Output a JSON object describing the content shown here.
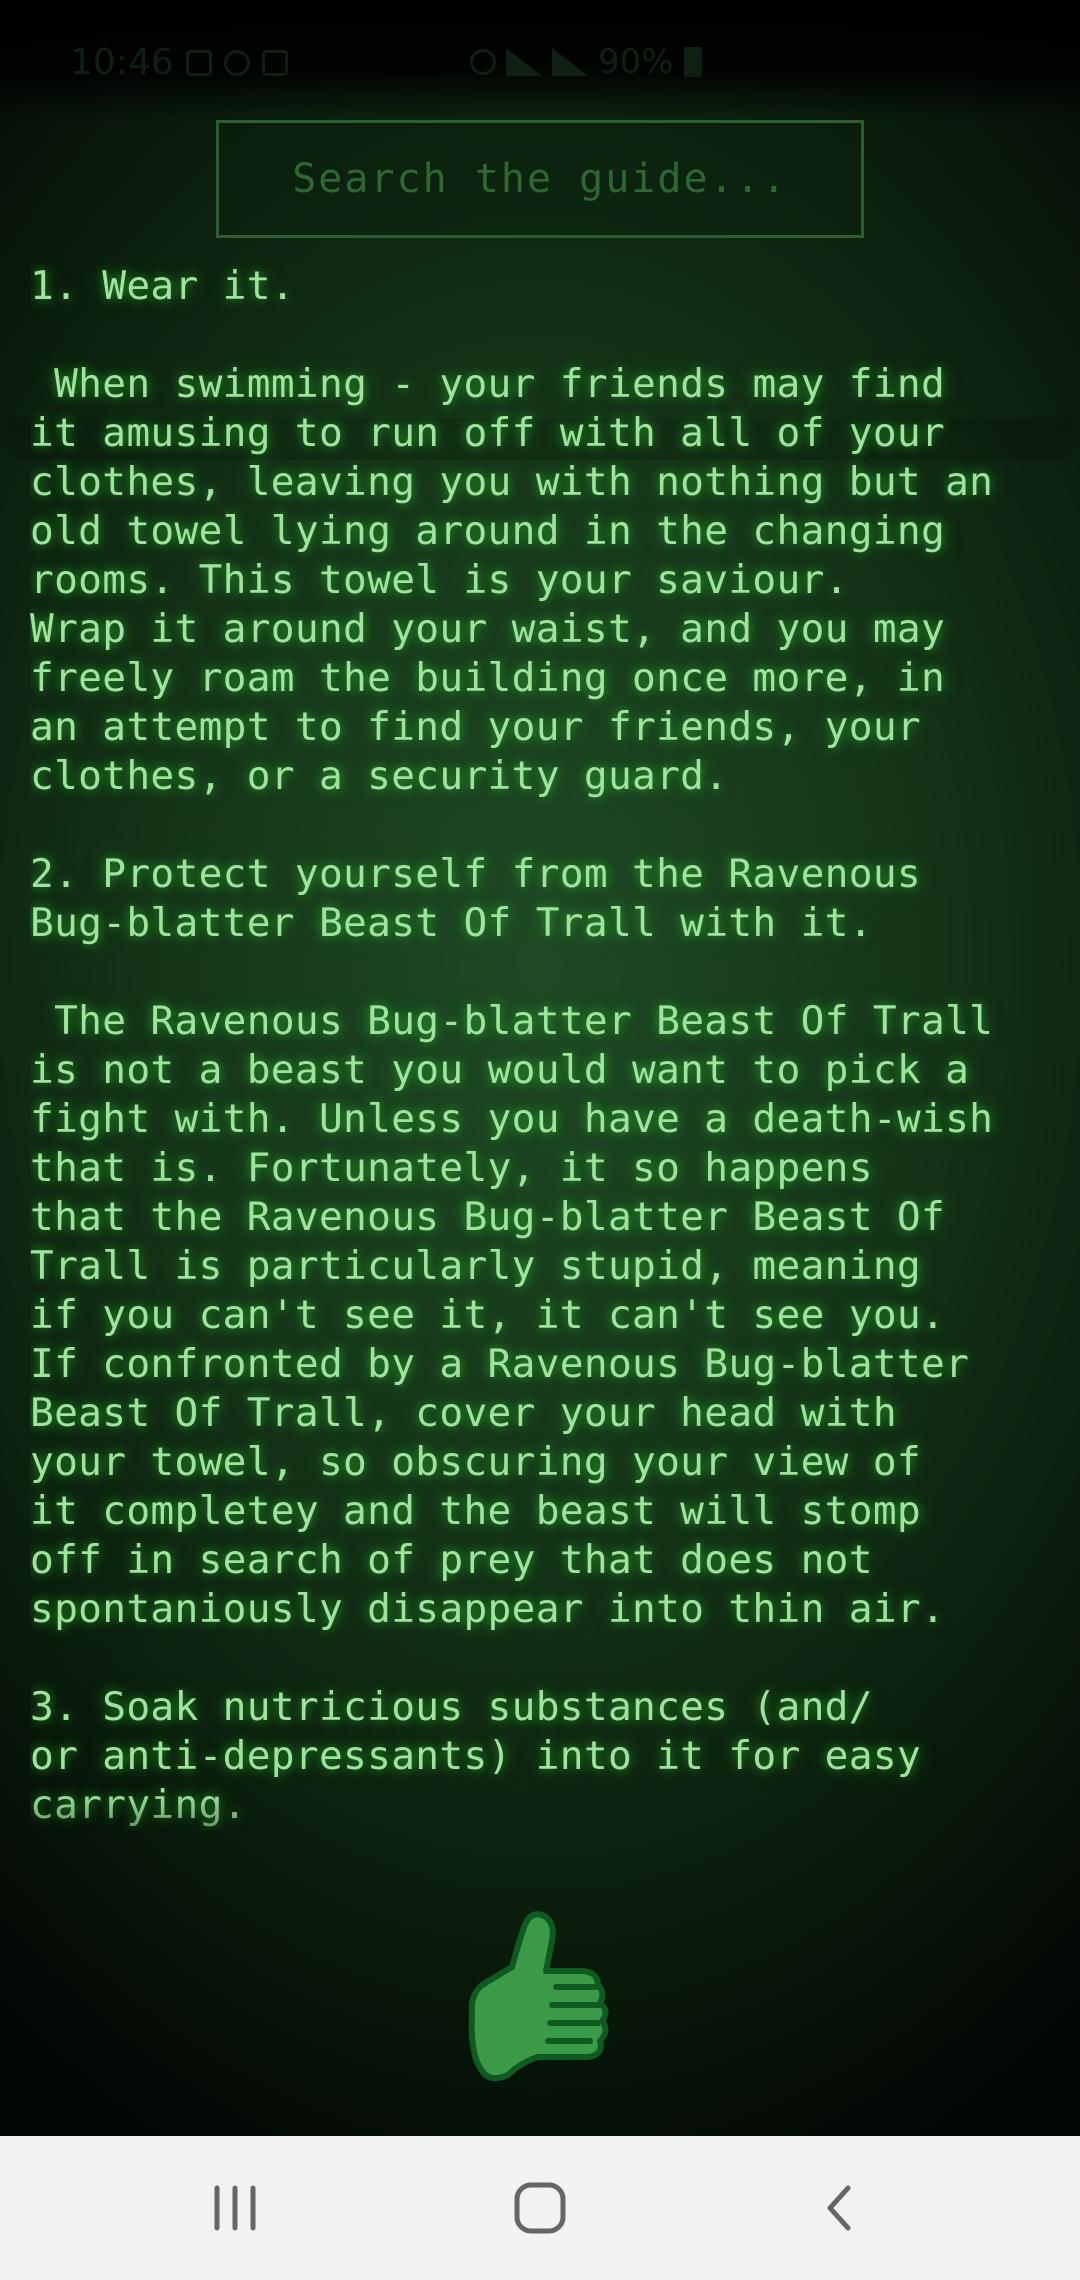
{
  "status_bar": {
    "time": "10:46",
    "battery": "90%",
    "left_icons": [
      "image-icon",
      "alarm-icon",
      "mail-icon"
    ],
    "right_icons": [
      "mute-icon",
      "wifi-icon",
      "signal-icon",
      "battery-icon"
    ]
  },
  "search": {
    "placeholder": "Search the guide...",
    "value": ""
  },
  "guide": {
    "text": "1. Wear it.\n\n When swimming - your friends may find\nit amusing to run off with all of your\nclothes, leaving you with nothing but an\nold towel lying around in the changing\nrooms. This towel is your saviour.\nWrap it around your waist, and you may\nfreely roam the building once more, in\nan attempt to find your friends, your\nclothes, or a security guard.\n\n2. Protect yourself from the Ravenous\nBug-blatter Beast Of Trall with it.\n\n The Ravenous Bug-blatter Beast Of Trall\nis not a beast you would want to pick a\nfight with. Unless you have a death-wish\nthat is. Fortunately, it so happens\nthat the Ravenous Bug-blatter Beast Of\nTrall is particularly stupid, meaning\nif you can't see it, it can't see you.\nIf confronted by a Ravenous Bug-blatter\nBeast Of Trall, cover your head with\nyour towel, so obscuring your view of\nit completey and the beast will stomp\noff in search of prey that does not\nspontaniously disappear into thin air.\n\n3. Soak nutricious substances (and/\nor anti-depressants) into it for easy\ncarrying."
  },
  "like_button": {
    "icon": "thumbs-up-icon"
  },
  "nav_bar": {
    "recent_icon": "recent-apps-icon",
    "home_icon": "home-icon",
    "back_icon": "back-icon"
  },
  "colors": {
    "background": "#143318",
    "text": "#9fe39f",
    "search_border": "#2d5e2f",
    "thumb_fill": "#3a9a48",
    "thumb_outline": "#0f5a20",
    "nav_background": "#f2f2f2",
    "nav_icon": "#666666"
  }
}
